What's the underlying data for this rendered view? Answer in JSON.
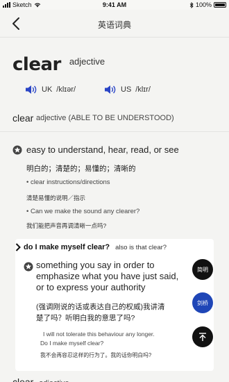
{
  "status": {
    "carrier": "Sketch",
    "time": "9:41 AM",
    "battery": "100%"
  },
  "nav": {
    "title": "英语词典"
  },
  "entry": {
    "headword": "clear",
    "pos": "adjective",
    "uk_label": "UK",
    "uk_ipa": "/klɪər/",
    "us_label": "US",
    "us_ipa": "/klɪr/"
  },
  "sense": {
    "word": "clear",
    "info": "adjective (ABLE TO BE UNDERSTOOD)"
  },
  "definition1": {
    "en": "easy to understand, hear, read, or see",
    "zh": "明白的；清楚的；易懂的；清晰的",
    "example1_en": "• clear instructions/directions",
    "example1_zh": "清楚易懂的说明／指示",
    "example2_en": "• Can we make the sound any clearer?",
    "example2_zh": "我们能把声音再调清晰一点吗?"
  },
  "idiom": {
    "phrase": "do I make myself clear?",
    "also": "also is that clear?",
    "def_en_line1": "something you say in order to",
    "def_en_line2": "emphasize what you have just said,",
    "def_en_line3": "or to express your authority",
    "def_zh_line1": "(强调刚说的话或表达自己的权威)我讲清",
    "def_zh_line2": "楚了吗？听明白我的意思了吗?",
    "example_en_line1": "I will not tolerate this behaviour any longer.",
    "example_en_line2": "Do I make myself clear?",
    "example_zh": "我不会再容忍这样的行为了。我的话你明白吗?"
  },
  "fabs": {
    "simple": "简明",
    "cambridge": "剑桥"
  },
  "next": {
    "word": "clear",
    "pos": "adjective"
  },
  "icons": {
    "back": "chevron-left-icon",
    "speaker": "speaker-icon",
    "star": "star-icon",
    "chevron": "chevron-right-icon",
    "top": "arrow-up-icon"
  },
  "colors": {
    "accent": "#1f46b7",
    "speaker": "#2a45c6",
    "fab_dark": "#111111"
  }
}
